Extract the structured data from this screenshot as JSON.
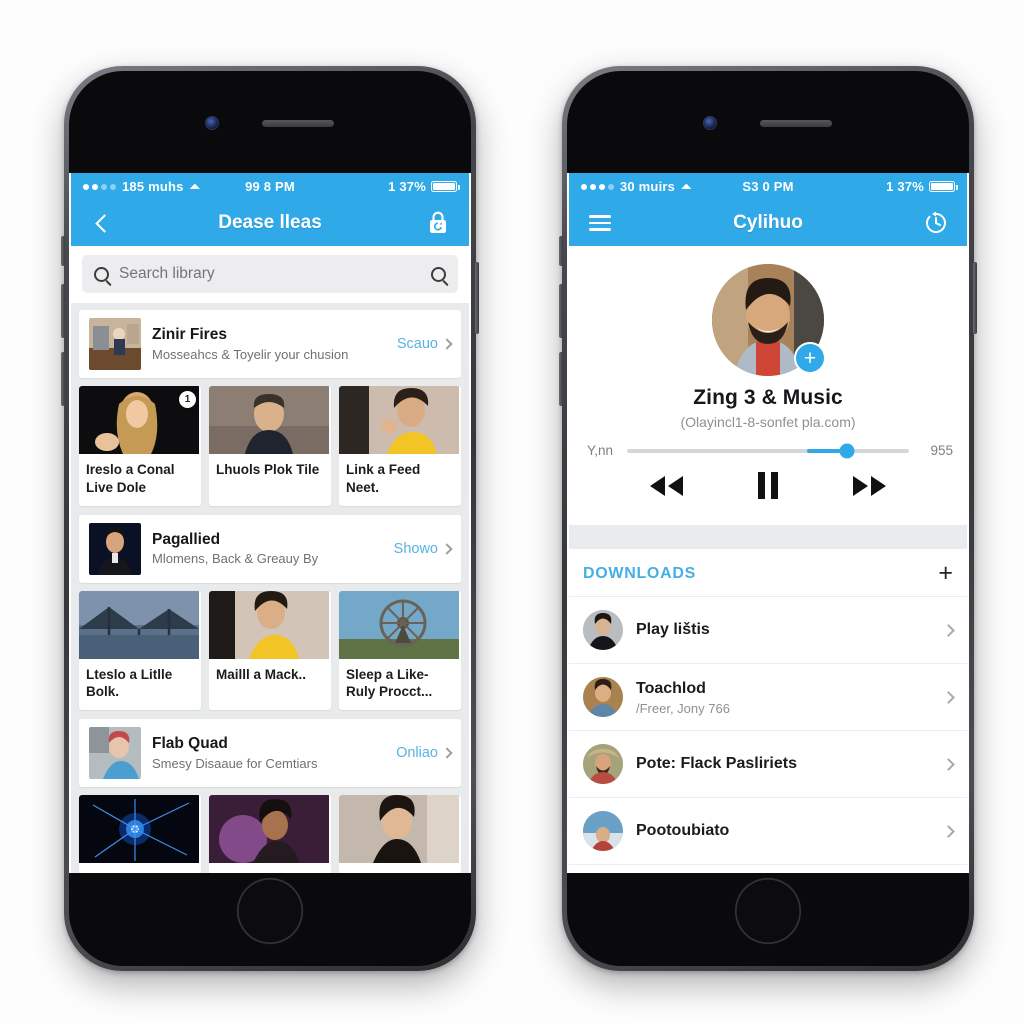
{
  "left_phone": {
    "status_bar": {
      "carrier": "185 muhs",
      "time": "99 8 PM",
      "battery": "1 37%",
      "wifi_icon": "wifi-icon",
      "signal_icon": "signal-dots-icon",
      "battery_icon": "battery-icon"
    },
    "nav": {
      "back_icon": "chevron-left-icon",
      "title": "Dease lleas",
      "right_icon": "lock-bag-icon"
    },
    "search": {
      "placeholder": "Search library",
      "left_icon": "search-icon",
      "right_icon": "search-icon"
    },
    "sections": [
      {
        "promo": {
          "title": "Zinir Fires",
          "subtitle": "Mosseahcs & Toyelir your chusion",
          "action": "Scauo",
          "thumb_icon": "photo-thumbnail"
        },
        "cards": [
          {
            "label": "Ireslo a Conal Live Dole",
            "badge": "1",
            "thumb_icon": "video-thumbnail"
          },
          {
            "label": "Lhuols Plok Tile",
            "badge": "",
            "thumb_icon": "video-thumbnail"
          },
          {
            "label": "Link a Feed Neet.",
            "badge": "",
            "thumb_icon": "video-thumbnail"
          }
        ]
      },
      {
        "promo": {
          "title": "Pagallied",
          "subtitle": "Mlomens, Back & Greauy By",
          "action": "Showo",
          "thumb_icon": "photo-thumbnail"
        },
        "cards": [
          {
            "label": "Lteslo a Litlle Bolk.",
            "badge": "",
            "thumb_icon": "video-thumbnail"
          },
          {
            "label": "Mailll a Mack..",
            "badge": "",
            "thumb_icon": "video-thumbnail"
          },
          {
            "label": "Sleep a Like- Ruly Procct...",
            "badge": "",
            "thumb_icon": "video-thumbnail"
          }
        ]
      },
      {
        "promo": {
          "title": "Flab Quad",
          "subtitle": "Smesy Disaaue for Cemtiars",
          "action": "Onliao",
          "thumb_icon": "photo-thumbnail"
        },
        "cards": [
          {
            "label": "",
            "badge": "",
            "thumb_icon": "video-thumbnail"
          },
          {
            "label": "",
            "badge": "",
            "thumb_icon": "video-thumbnail"
          },
          {
            "label": "",
            "badge": "",
            "thumb_icon": "video-thumbnail"
          }
        ]
      }
    ]
  },
  "right_phone": {
    "status_bar": {
      "carrier": "30 muirs",
      "time": "S3 0 PM",
      "battery": "1 37%",
      "wifi_icon": "wifi-icon",
      "signal_icon": "signal-dots-icon",
      "battery_icon": "battery-icon"
    },
    "nav": {
      "menu_icon": "hamburger-menu-icon",
      "title": "Cylihuo",
      "right_icon": "refresh-timer-icon"
    },
    "player": {
      "avatar_icon": "user-avatar",
      "add_button": "+",
      "title": "Zing 3 & Music",
      "subtitle": "(Olayincl1-8-sonfet pla.com)",
      "elapsed": "Y,nn",
      "remaining": "955",
      "progress_percent": 78,
      "rewind_icon": "rewind-icon",
      "pause_icon": "pause-icon",
      "forward_icon": "fast-forward-icon"
    },
    "downloads": {
      "header": "DOWNLOADS",
      "add_icon": "plus-icon",
      "items": [
        {
          "name": "Play lištis",
          "meta": "",
          "avatar_icon": "user-avatar",
          "chevron_icon": "chevron-right-icon"
        },
        {
          "name": "Toachlod",
          "meta": "/Freer, Jony 766",
          "avatar_icon": "user-avatar",
          "chevron_icon": "chevron-right-icon"
        },
        {
          "name": "Pote: Flack Pasliriets",
          "meta": "",
          "avatar_icon": "user-avatar",
          "chevron_icon": "chevron-right-icon"
        },
        {
          "name": "Pootoubiato",
          "meta": "",
          "avatar_icon": "user-avatar",
          "chevron_icon": "chevron-right-icon"
        }
      ]
    }
  },
  "colors": {
    "accent_blue": "#2FA9E8",
    "link_blue": "#56b4e2",
    "background": "#ffffff",
    "list_background": "#e9eaec"
  }
}
